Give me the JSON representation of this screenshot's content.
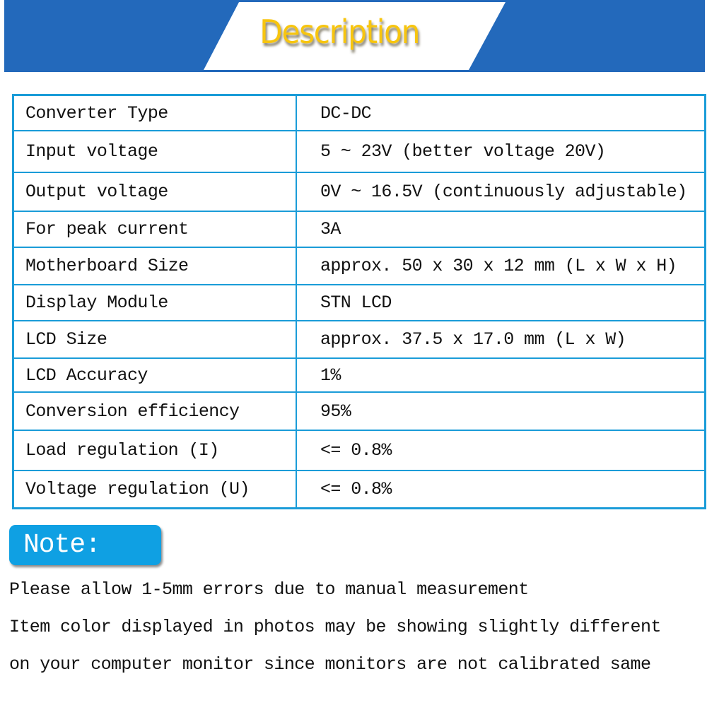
{
  "header": {
    "title": "Description",
    "banner_color": "#2369bb",
    "title_color": "#f7c50f"
  },
  "spec_table": {
    "border_color": "#1a9cd8",
    "rows": [
      {
        "label": "Converter Type",
        "value": "DC-DC"
      },
      {
        "label": "Input voltage",
        "value": "5 ~ 23V (better voltage 20V)"
      },
      {
        "label": "Output voltage",
        "value": "0V ~ 16.5V (continuously adjustable)"
      },
      {
        "label": "For peak current",
        "value": "3A"
      },
      {
        "label": "Motherboard Size",
        "value": "approx. 50 x 30 x 12 mm (L x W x H)"
      },
      {
        "label": "Display Module",
        "value": "STN LCD"
      },
      {
        "label": "LCD Size",
        "value": "approx. 37.5 x 17.0 mm (L x W)"
      },
      {
        "label": "LCD Accuracy",
        "value": "1%"
      },
      {
        "label": "Conversion efficiency",
        "value": "95%"
      },
      {
        "label": "Load regulation (I)",
        "value": "<= 0.8%"
      },
      {
        "label": "Voltage regulation (U)",
        "value": "<= 0.8%"
      }
    ]
  },
  "note": {
    "badge_label": "Note:",
    "badge_color": "#0fa0e3",
    "lines": [
      "Please allow 1-5mm errors due to manual measurement",
      "Item color displayed in photos may be showing slightly different",
      "on your computer monitor since monitors are not calibrated same"
    ]
  }
}
